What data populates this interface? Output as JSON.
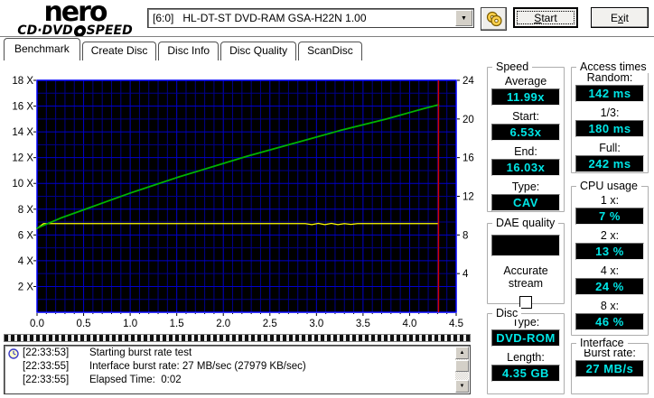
{
  "logo": {
    "name": "nero",
    "product_left": "CD·DVD",
    "product_right": "SPEED"
  },
  "header": {
    "drive": "[6:0]   HL-DT-ST DVD-RAM GSA-H22N 1.00",
    "start": {
      "label": "Start",
      "underline": 0
    },
    "exit": {
      "label": "Exit",
      "underline": 1
    }
  },
  "tabs": [
    {
      "label": "Benchmark",
      "active": true
    },
    {
      "label": "Create Disc",
      "active": false
    },
    {
      "label": "Disc Info",
      "active": false
    },
    {
      "label": "Disc Quality",
      "active": false
    },
    {
      "label": "ScanDisc",
      "active": false
    }
  ],
  "chart_data": {
    "type": "line",
    "title": "",
    "xlabel": "",
    "ylabel_left": "",
    "ylabel_right": "",
    "xlim": [
      0,
      4.5
    ],
    "x_major_step": 0.5,
    "x_minor_step": 0.1,
    "x_tick_labels": [
      "0.0",
      "0.5",
      "1.0",
      "1.5",
      "2.0",
      "2.5",
      "3.0",
      "3.5",
      "4.0",
      "4.5"
    ],
    "ylim_left": [
      0,
      18
    ],
    "y_left_ticks": [
      2,
      4,
      6,
      8,
      10,
      12,
      14,
      16,
      18
    ],
    "y_left_suffix": " X",
    "ylim_right": [
      0,
      24
    ],
    "y_right_ticks": [
      4,
      8,
      12,
      16,
      20,
      24
    ],
    "grid": true,
    "bg_color": "#000000",
    "grid_minor_color": "#00008b",
    "grid_major_color": "#0000cd",
    "border_color": "#0000ff",
    "cursor_x": 4.31,
    "cursor_color": "#d40000",
    "series": [
      {
        "name": "read-speed",
        "color": "#00b400",
        "width": 1.8,
        "points": [
          [
            0,
            6.53
          ],
          [
            0.25,
            7.3
          ],
          [
            0.5,
            7.95
          ],
          [
            0.75,
            8.6
          ],
          [
            1.0,
            9.25
          ],
          [
            1.25,
            9.85
          ],
          [
            1.5,
            10.45
          ],
          [
            1.75,
            11.0
          ],
          [
            2.0,
            11.55
          ],
          [
            2.25,
            12.1
          ],
          [
            2.5,
            12.6
          ],
          [
            2.75,
            13.1
          ],
          [
            3.0,
            13.6
          ],
          [
            3.25,
            14.1
          ],
          [
            3.5,
            14.55
          ],
          [
            3.75,
            15.0
          ],
          [
            4.0,
            15.5
          ],
          [
            4.15,
            15.8
          ],
          [
            4.31,
            16.1
          ]
        ]
      },
      {
        "name": "rotation-speed",
        "color": "#ffff00",
        "width": 1.3,
        "points": [
          [
            0,
            6.5
          ],
          [
            0.07,
            6.88
          ],
          [
            2.88,
            6.88
          ],
          [
            2.95,
            6.8
          ],
          [
            3.02,
            6.9
          ],
          [
            3.09,
            6.8
          ],
          [
            3.16,
            6.9
          ],
          [
            3.23,
            6.8
          ],
          [
            3.3,
            6.88
          ],
          [
            3.37,
            6.82
          ],
          [
            3.44,
            6.88
          ],
          [
            4.31,
            6.88
          ]
        ]
      }
    ]
  },
  "log": {
    "lines": [
      {
        "time": "[22:33:53]",
        "text": "Starting burst rate test"
      },
      {
        "time": "[22:33:55]",
        "text": "Interface burst rate: 27 MB/sec (27979 KB/sec)"
      },
      {
        "time": "[22:33:55]",
        "text": "Elapsed Time:  0:02"
      }
    ]
  },
  "panels": {
    "speed": {
      "title": "Speed",
      "fields": [
        {
          "label": "Average",
          "value": "11.99x"
        },
        {
          "label": "Start:",
          "value": "6.53x"
        },
        {
          "label": "End:",
          "value": "16.03x"
        },
        {
          "label": "Type:",
          "value": "CAV"
        }
      ]
    },
    "access": {
      "title": "Access times",
      "fields": [
        {
          "label": "Random:",
          "value": "142 ms"
        },
        {
          "label": "1/3:",
          "value": "180 ms"
        },
        {
          "label": "Full:",
          "value": "242 ms"
        }
      ]
    },
    "cpu": {
      "title": "CPU usage",
      "fields": [
        {
          "label": "1 x:",
          "value": "7 %"
        },
        {
          "label": "2 x:",
          "value": "13 %"
        },
        {
          "label": "4 x:",
          "value": "24 %"
        },
        {
          "label": "8 x:",
          "value": "46 %"
        }
      ]
    },
    "dae": {
      "title": "DAE quality",
      "accurate_label_1": "Accurate",
      "accurate_label_2": "stream",
      "checkbox_checked": false
    },
    "disc": {
      "title": "Disc",
      "fields": [
        {
          "label": "Type:",
          "value": "DVD-ROM"
        },
        {
          "label": "Length:",
          "value": "4.35 GB"
        }
      ]
    },
    "interface": {
      "title": "Interface",
      "fields": [
        {
          "label": "Burst rate:",
          "value": "27 MB/s"
        }
      ]
    }
  },
  "colors": {
    "lcd_bg": "#000000",
    "lcd_text": "#00e6e6",
    "window_bg": "#ffffff"
  }
}
